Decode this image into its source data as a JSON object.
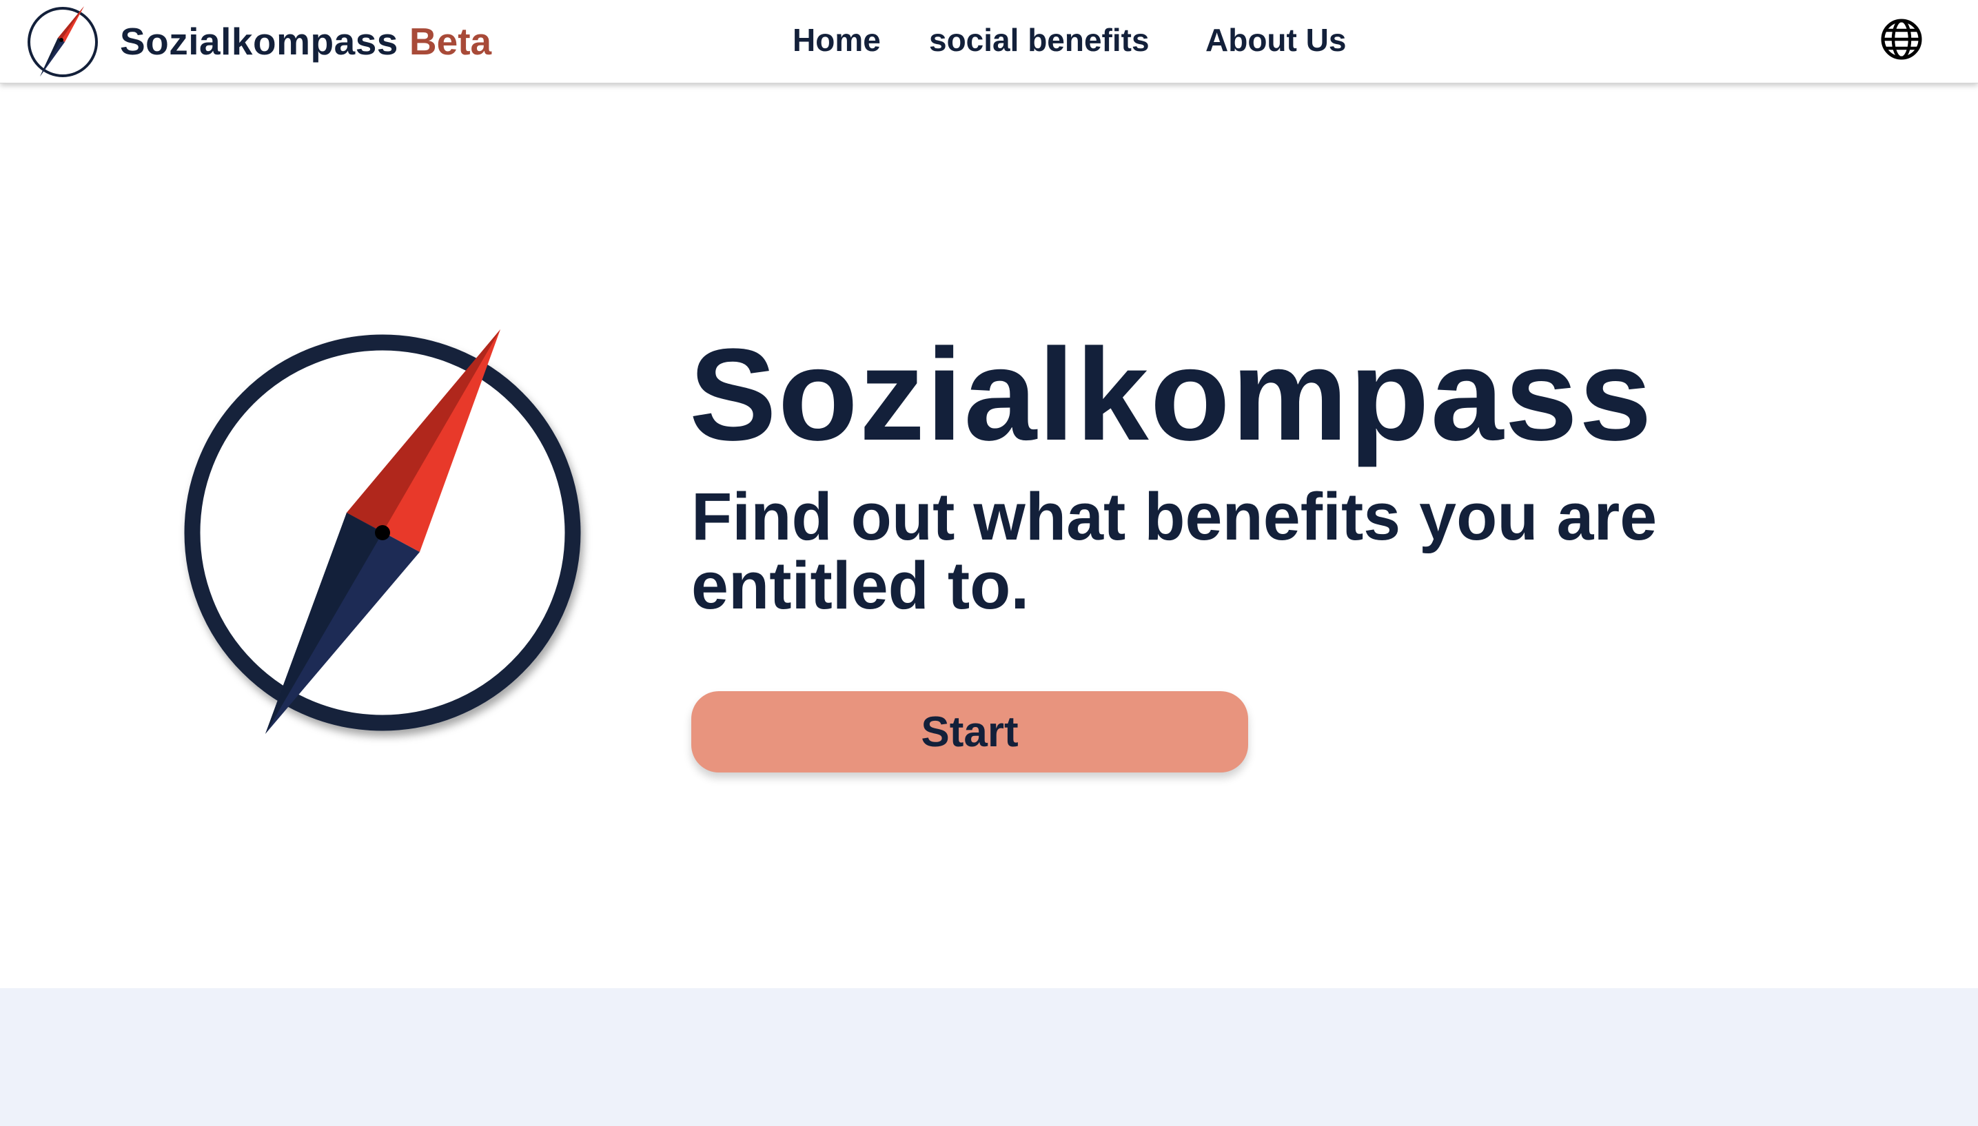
{
  "header": {
    "brand_name": "Sozialkompass",
    "brand_tag": "Beta",
    "nav": [
      {
        "label": "Home"
      },
      {
        "label": "social benefits"
      },
      {
        "label": "About Us"
      }
    ],
    "language_icon": "globe-icon"
  },
  "hero": {
    "logo_icon": "compass-icon",
    "title": "Sozialkompass",
    "subtitle": "Find out what benefits you are entitled to.",
    "start_label": "Start"
  },
  "colors": {
    "navy": "#13203a",
    "needle_red": "#e8392a",
    "needle_dark_red": "#b0271c",
    "needle_blue": "#1d2b55",
    "beta": "#a84a38",
    "start_button": "#e8947e",
    "lower_band": "#eef2fa"
  }
}
